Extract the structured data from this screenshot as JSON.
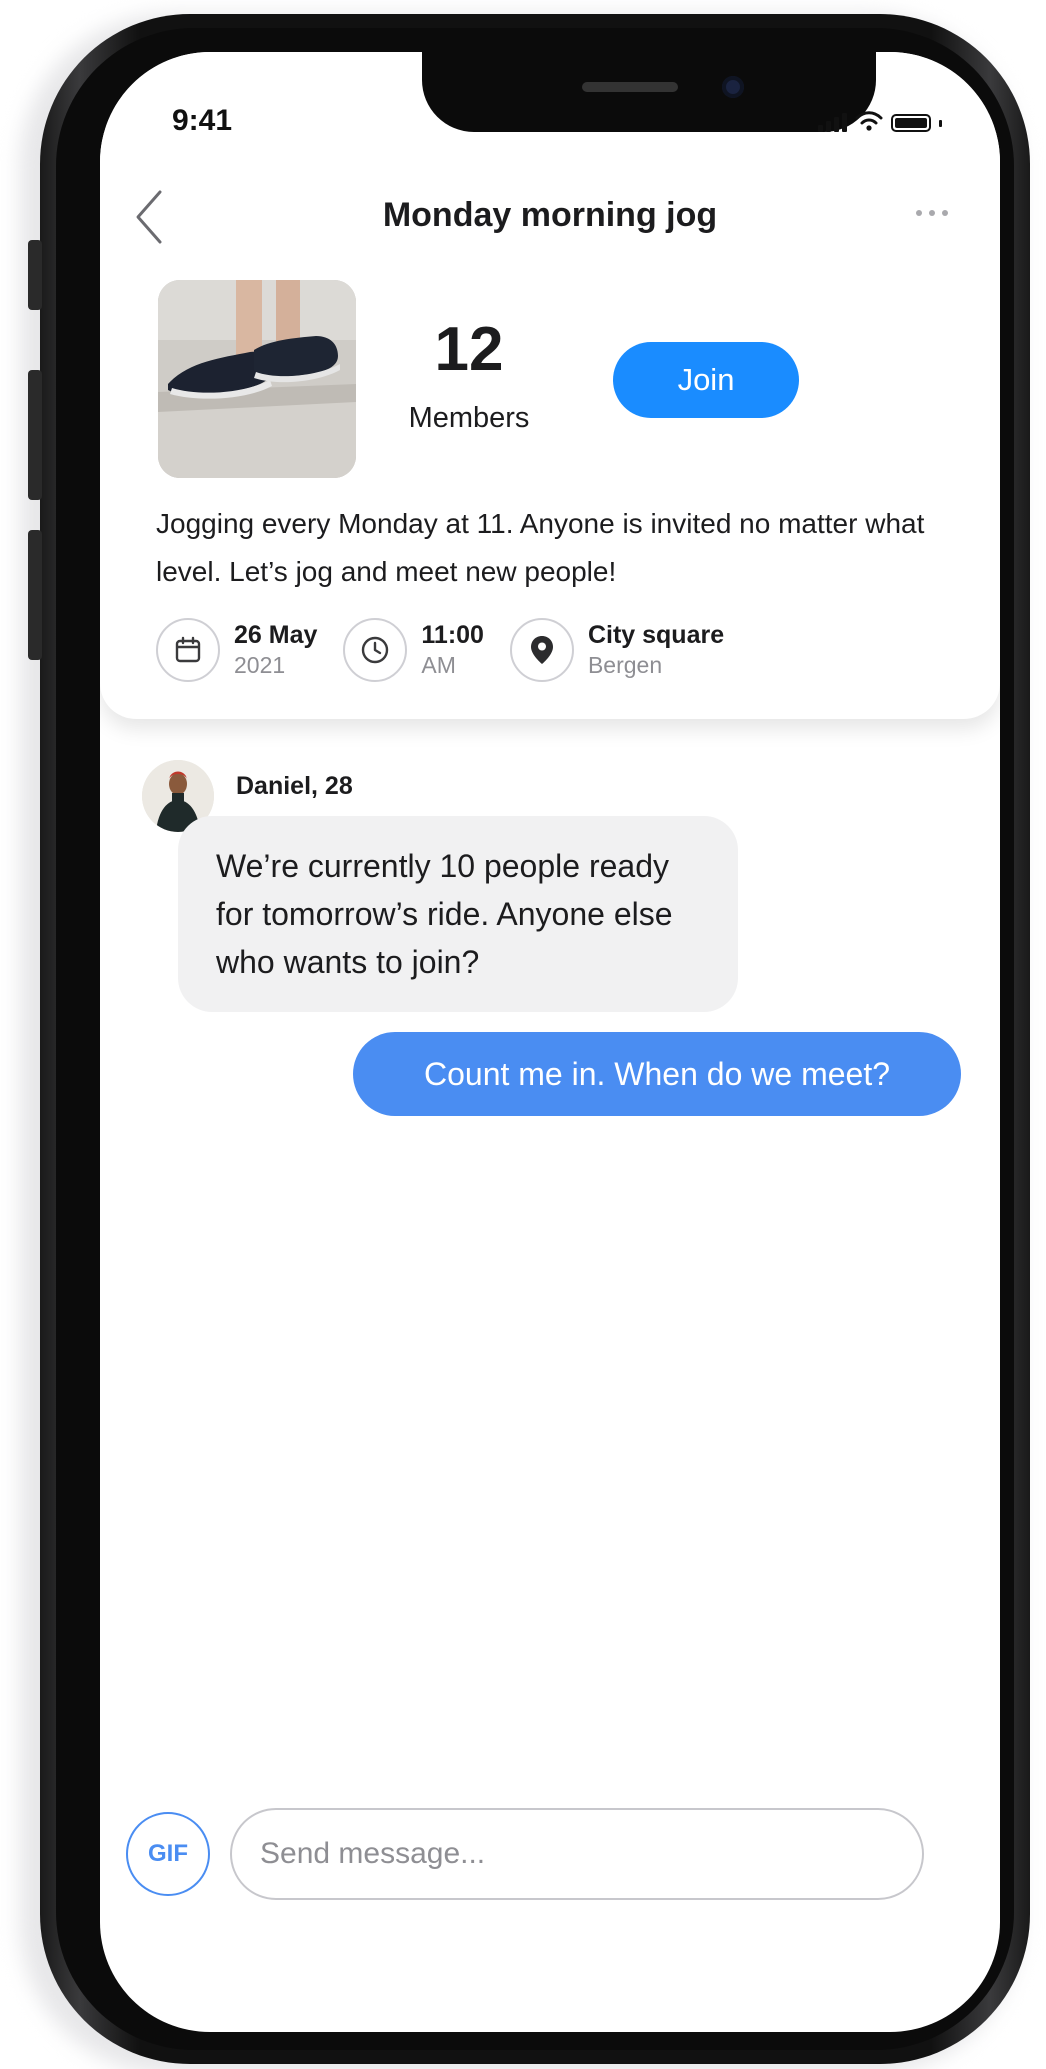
{
  "status_bar": {
    "time": "9:41"
  },
  "header": {
    "title": "Monday morning jog"
  },
  "group": {
    "members_count": "12",
    "members_label": "Members",
    "join_label": "Join",
    "description": "Jogging every Monday at 11. Anyone is invited no matter what level. Let’s jog and meet new people!",
    "date": {
      "primary": "26 May",
      "secondary": "2021"
    },
    "time": {
      "primary": "11:00",
      "secondary": "AM"
    },
    "location": {
      "primary": "City square",
      "secondary": "Bergen"
    }
  },
  "chat": {
    "messages": [
      {
        "sender": "Daniel, 28",
        "text": "We’re currently 10 people ready for tomorrow’s ride. Anyone else who wants to join?",
        "direction": "incoming"
      },
      {
        "text": "Count me in. When do we meet?",
        "direction": "outgoing"
      }
    ]
  },
  "composer": {
    "gif_label": "GIF",
    "placeholder": "Send message..."
  },
  "colors": {
    "accent": "#1a8cff",
    "outgoing_bubble": "#4a8df2",
    "incoming_bubble": "#f1f1f2"
  },
  "icons": {
    "back": "chevron-left-icon",
    "more": "more-horizontal-icon",
    "date": "calendar-icon",
    "time": "clock-icon",
    "location": "map-pin-icon"
  }
}
